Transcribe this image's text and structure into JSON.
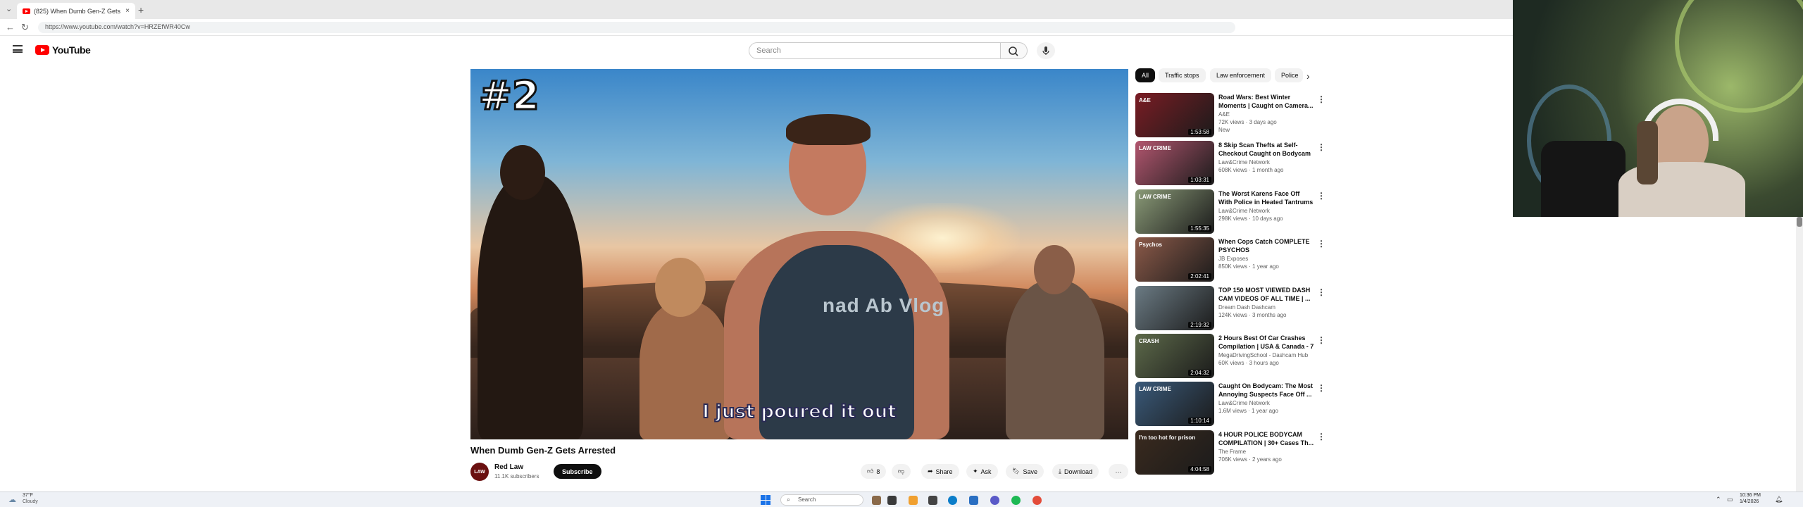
{
  "browser": {
    "tab_title": "(825) When Dumb Gen-Z Gets",
    "tab_close": "×",
    "new_tab": "+",
    "url": "https://www.youtube.com/watch?v=HRZEfWR40Cw"
  },
  "masthead": {
    "logo_text": "YouTube",
    "search_placeholder": "Search"
  },
  "video": {
    "rank_overlay": "#2",
    "shirt_text": "nad Ab Vlog",
    "subtitle": "I just poured it out",
    "title": "When Dumb Gen-Z Gets Arrested"
  },
  "channel": {
    "avatar_text": "LAW",
    "name": "Red Law",
    "subscribers": "11.1K subscribers",
    "subscribe_label": "Subscribe"
  },
  "actions": {
    "like_count": "8",
    "share_label": "Share",
    "ask_label": "Ask",
    "save_label": "Save",
    "download_label": "Download",
    "more_label": "···"
  },
  "chips": [
    "All",
    "Traffic stops",
    "Law enforcement",
    "Police"
  ],
  "recommendations": [
    {
      "title": "Road Wars: Best Winter Moments | Caught on Camera...",
      "channel": "A&E",
      "meta": "72K views · 3 days ago",
      "extra": "New",
      "duration": "1:53:58",
      "bg": "#7a1c24",
      "badge": "A&E"
    },
    {
      "title": "8 Skip Scan Thefts at Self-Checkout Caught on Bodycam",
      "channel": "Law&Crime Network",
      "meta": "608K views · 1 month ago",
      "extra": "",
      "duration": "1:03:31",
      "bg": "#b2566f",
      "badge": "LAW CRIME"
    },
    {
      "title": "The Worst Karens Face Off With Police in Heated Tantrums",
      "channel": "Law&Crime Network",
      "meta": "298K views · 10 days ago",
      "extra": "",
      "duration": "1:55:35",
      "bg": "#8a9a77",
      "badge": "LAW CRIME"
    },
    {
      "title": "When Cops Catch COMPLETE PSYCHOS",
      "channel": "JB Exposes",
      "meta": "850K views · 1 year ago",
      "extra": "",
      "duration": "2:02:41",
      "bg": "#8c5a49",
      "badge": "Psychos"
    },
    {
      "title": "TOP 150 MOST VIEWED DASH CAM VIDEOS OF ALL TIME | ...",
      "channel": "Dream Dash Dashcam",
      "meta": "124K views · 3 months ago",
      "extra": "",
      "duration": "2:19:32",
      "bg": "#6b7b84",
      "badge": ""
    },
    {
      "title": "2 Hours Best Of Car Crashes Compilation | USA & Canada - 7",
      "channel": "MegaDrivingSchool - Dashcam Hub",
      "meta": "60K views · 3 hours ago",
      "extra": "",
      "duration": "2:04:32",
      "bg": "#5d6a4a",
      "badge": "CRASH"
    },
    {
      "title": "Caught On Bodycam: The Most Annoying Suspects Face Off ...",
      "channel": "Law&Crime Network",
      "meta": "1.6M views · 1 year ago",
      "extra": "",
      "duration": "1:10:14",
      "bg": "#3a5a7a",
      "badge": "LAW CRIME"
    },
    {
      "title": "4 HOUR POLICE BODYCAM COMPILATION | 30+ Cases Th...",
      "channel": "The Frame",
      "meta": "706K views · 2 years ago",
      "extra": "",
      "duration": "4:04:58",
      "bg": "#3a2a1e",
      "badge": "I'm too hot for prison"
    }
  ],
  "taskbar": {
    "weather_temp": "37°F",
    "weather_cond": "Cloudy",
    "search_label": "Search",
    "time": "10:36 PM",
    "date": "1/4/2026"
  },
  "colors": {
    "youtube_red": "#ff0000",
    "chip_selected": "#0f0f0f",
    "subscribe_bg": "#0f0f0f"
  }
}
